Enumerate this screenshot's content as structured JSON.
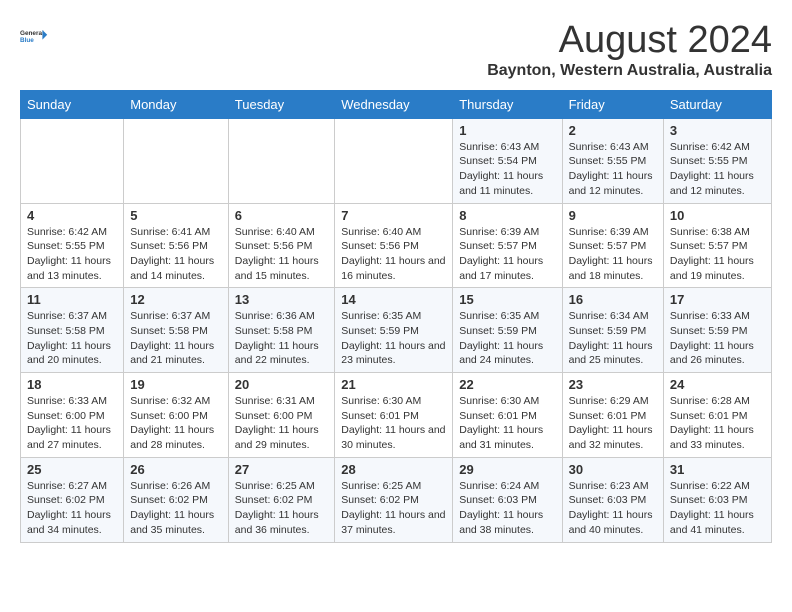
{
  "logo": {
    "line1": "General",
    "line2": "Blue"
  },
  "title": "August 2024",
  "subtitle": "Baynton, Western Australia, Australia",
  "days_of_week": [
    "Sunday",
    "Monday",
    "Tuesday",
    "Wednesday",
    "Thursday",
    "Friday",
    "Saturday"
  ],
  "weeks": [
    [
      {
        "day": "",
        "details": ""
      },
      {
        "day": "",
        "details": ""
      },
      {
        "day": "",
        "details": ""
      },
      {
        "day": "",
        "details": ""
      },
      {
        "day": "1",
        "details": "Sunrise: 6:43 AM\nSunset: 5:54 PM\nDaylight: 11 hours and 11 minutes."
      },
      {
        "day": "2",
        "details": "Sunrise: 6:43 AM\nSunset: 5:55 PM\nDaylight: 11 hours and 12 minutes."
      },
      {
        "day": "3",
        "details": "Sunrise: 6:42 AM\nSunset: 5:55 PM\nDaylight: 11 hours and 12 minutes."
      }
    ],
    [
      {
        "day": "4",
        "details": "Sunrise: 6:42 AM\nSunset: 5:55 PM\nDaylight: 11 hours and 13 minutes."
      },
      {
        "day": "5",
        "details": "Sunrise: 6:41 AM\nSunset: 5:56 PM\nDaylight: 11 hours and 14 minutes."
      },
      {
        "day": "6",
        "details": "Sunrise: 6:40 AM\nSunset: 5:56 PM\nDaylight: 11 hours and 15 minutes."
      },
      {
        "day": "7",
        "details": "Sunrise: 6:40 AM\nSunset: 5:56 PM\nDaylight: 11 hours and 16 minutes."
      },
      {
        "day": "8",
        "details": "Sunrise: 6:39 AM\nSunset: 5:57 PM\nDaylight: 11 hours and 17 minutes."
      },
      {
        "day": "9",
        "details": "Sunrise: 6:39 AM\nSunset: 5:57 PM\nDaylight: 11 hours and 18 minutes."
      },
      {
        "day": "10",
        "details": "Sunrise: 6:38 AM\nSunset: 5:57 PM\nDaylight: 11 hours and 19 minutes."
      }
    ],
    [
      {
        "day": "11",
        "details": "Sunrise: 6:37 AM\nSunset: 5:58 PM\nDaylight: 11 hours and 20 minutes."
      },
      {
        "day": "12",
        "details": "Sunrise: 6:37 AM\nSunset: 5:58 PM\nDaylight: 11 hours and 21 minutes."
      },
      {
        "day": "13",
        "details": "Sunrise: 6:36 AM\nSunset: 5:58 PM\nDaylight: 11 hours and 22 minutes."
      },
      {
        "day": "14",
        "details": "Sunrise: 6:35 AM\nSunset: 5:59 PM\nDaylight: 11 hours and 23 minutes."
      },
      {
        "day": "15",
        "details": "Sunrise: 6:35 AM\nSunset: 5:59 PM\nDaylight: 11 hours and 24 minutes."
      },
      {
        "day": "16",
        "details": "Sunrise: 6:34 AM\nSunset: 5:59 PM\nDaylight: 11 hours and 25 minutes."
      },
      {
        "day": "17",
        "details": "Sunrise: 6:33 AM\nSunset: 5:59 PM\nDaylight: 11 hours and 26 minutes."
      }
    ],
    [
      {
        "day": "18",
        "details": "Sunrise: 6:33 AM\nSunset: 6:00 PM\nDaylight: 11 hours and 27 minutes."
      },
      {
        "day": "19",
        "details": "Sunrise: 6:32 AM\nSunset: 6:00 PM\nDaylight: 11 hours and 28 minutes."
      },
      {
        "day": "20",
        "details": "Sunrise: 6:31 AM\nSunset: 6:00 PM\nDaylight: 11 hours and 29 minutes."
      },
      {
        "day": "21",
        "details": "Sunrise: 6:30 AM\nSunset: 6:01 PM\nDaylight: 11 hours and 30 minutes."
      },
      {
        "day": "22",
        "details": "Sunrise: 6:30 AM\nSunset: 6:01 PM\nDaylight: 11 hours and 31 minutes."
      },
      {
        "day": "23",
        "details": "Sunrise: 6:29 AM\nSunset: 6:01 PM\nDaylight: 11 hours and 32 minutes."
      },
      {
        "day": "24",
        "details": "Sunrise: 6:28 AM\nSunset: 6:01 PM\nDaylight: 11 hours and 33 minutes."
      }
    ],
    [
      {
        "day": "25",
        "details": "Sunrise: 6:27 AM\nSunset: 6:02 PM\nDaylight: 11 hours and 34 minutes."
      },
      {
        "day": "26",
        "details": "Sunrise: 6:26 AM\nSunset: 6:02 PM\nDaylight: 11 hours and 35 minutes."
      },
      {
        "day": "27",
        "details": "Sunrise: 6:25 AM\nSunset: 6:02 PM\nDaylight: 11 hours and 36 minutes."
      },
      {
        "day": "28",
        "details": "Sunrise: 6:25 AM\nSunset: 6:02 PM\nDaylight: 11 hours and 37 minutes."
      },
      {
        "day": "29",
        "details": "Sunrise: 6:24 AM\nSunset: 6:03 PM\nDaylight: 11 hours and 38 minutes."
      },
      {
        "day": "30",
        "details": "Sunrise: 6:23 AM\nSunset: 6:03 PM\nDaylight: 11 hours and 40 minutes."
      },
      {
        "day": "31",
        "details": "Sunrise: 6:22 AM\nSunset: 6:03 PM\nDaylight: 11 hours and 41 minutes."
      }
    ]
  ]
}
